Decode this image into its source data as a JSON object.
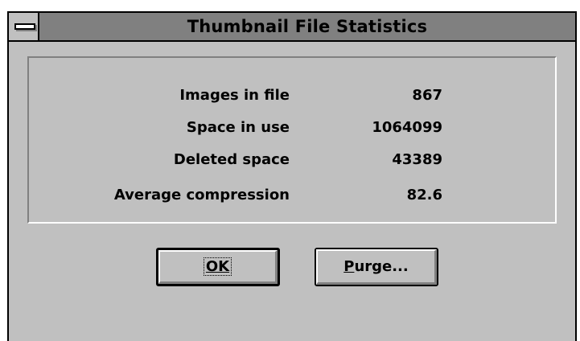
{
  "window": {
    "title": "Thumbnail File Statistics"
  },
  "stats": [
    {
      "label": "Images in file",
      "value": "867"
    },
    {
      "label": "Space in use",
      "value": "1064099"
    },
    {
      "label": "Deleted space",
      "value": "43389"
    },
    {
      "label": "Average compression",
      "value": "82.6"
    }
  ],
  "buttons": {
    "ok_label": "OK",
    "purge_prefix": "P",
    "purge_rest": "urge..."
  },
  "colors": {
    "face": "#c0c0c0",
    "titlebar": "#808080",
    "shadow": "#808080",
    "highlight": "#ffffff",
    "frame": "#000000"
  }
}
